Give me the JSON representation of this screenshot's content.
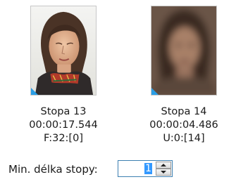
{
  "tracks": [
    {
      "title": "Stopa 13",
      "time": "00:00:17.544",
      "info": "F:32:[0]",
      "icon": "face-thumbnail-sharp-icon"
    },
    {
      "title": "Stopa 14",
      "time": "00:00:04.486",
      "info": "U:0:[14]",
      "icon": "face-thumbnail-blurred-icon"
    }
  ],
  "min_length": {
    "label": "Min. délka stopy:",
    "value": "1"
  },
  "colors": {
    "selection": "#3399ff",
    "corner_marker": "#2a9ee6",
    "spin_border": "#3c7fb1"
  }
}
